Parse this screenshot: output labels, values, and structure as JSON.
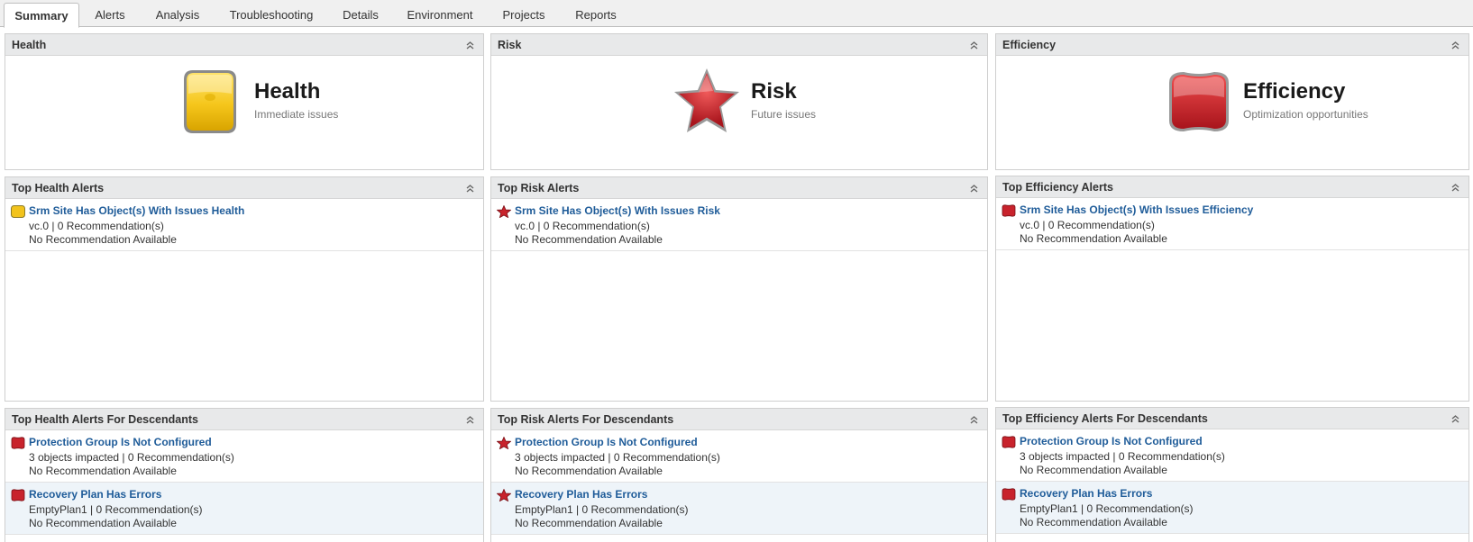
{
  "tabs": [
    {
      "label": "Summary"
    },
    {
      "label": "Alerts"
    },
    {
      "label": "Analysis"
    },
    {
      "label": "Troubleshooting"
    },
    {
      "label": "Details"
    },
    {
      "label": "Environment"
    },
    {
      "label": "Projects"
    },
    {
      "label": "Reports"
    }
  ],
  "summary": {
    "health": {
      "header": "Health",
      "title": "Health",
      "subtitle": "Immediate issues"
    },
    "risk": {
      "header": "Risk",
      "title": "Risk",
      "subtitle": "Future issues"
    },
    "efficiency": {
      "header": "Efficiency",
      "title": "Efficiency",
      "subtitle": "Optimization opportunities"
    }
  },
  "top_alerts": {
    "health": {
      "header": "Top Health Alerts",
      "items": [
        {
          "title": "Srm Site Has Object(s) With Issues Health",
          "detail": "vc.0 | 0 Recommendation(s)",
          "recommendation": "No Recommendation Available"
        }
      ]
    },
    "risk": {
      "header": "Top Risk Alerts",
      "items": [
        {
          "title": "Srm Site Has Object(s) With Issues Risk",
          "detail": "vc.0 | 0 Recommendation(s)",
          "recommendation": "No Recommendation Available"
        }
      ]
    },
    "efficiency": {
      "header": "Top Efficiency Alerts",
      "items": [
        {
          "title": "Srm Site Has Object(s) With Issues Efficiency",
          "detail": "vc.0 | 0 Recommendation(s)",
          "recommendation": "No Recommendation Available"
        }
      ]
    }
  },
  "descendant_alerts": {
    "health": {
      "header": "Top Health Alerts For Descendants",
      "items": [
        {
          "title": "Protection Group Is Not Configured",
          "detail": "3 objects impacted | 0 Recommendation(s)",
          "recommendation": "No Recommendation Available"
        },
        {
          "title": "Recovery Plan Has Errors",
          "detail": "EmptyPlan1 | 0 Recommendation(s)",
          "recommendation": "No Recommendation Available"
        }
      ]
    },
    "risk": {
      "header": "Top Risk Alerts For Descendants",
      "items": [
        {
          "title": "Protection Group Is Not Configured",
          "detail": "3 objects impacted | 0 Recommendation(s)",
          "recommendation": "No Recommendation Available"
        },
        {
          "title": "Recovery Plan Has Errors",
          "detail": "EmptyPlan1 | 0 Recommendation(s)",
          "recommendation": "No Recommendation Available"
        }
      ]
    },
    "efficiency": {
      "header": "Top Efficiency Alerts For Descendants",
      "items": [
        {
          "title": "Protection Group Is Not Configured",
          "detail": "3 objects impacted | 0 Recommendation(s)",
          "recommendation": "No Recommendation Available"
        },
        {
          "title": "Recovery Plan Has Errors",
          "detail": "EmptyPlan1 | 0 Recommendation(s)",
          "recommendation": "No Recommendation Available"
        }
      ]
    }
  },
  "colors": {
    "health_badge": "#f2c31c",
    "risk_badge": "#c8232c",
    "efficiency_badge": "#c8232c",
    "link": "#1f5c99"
  }
}
